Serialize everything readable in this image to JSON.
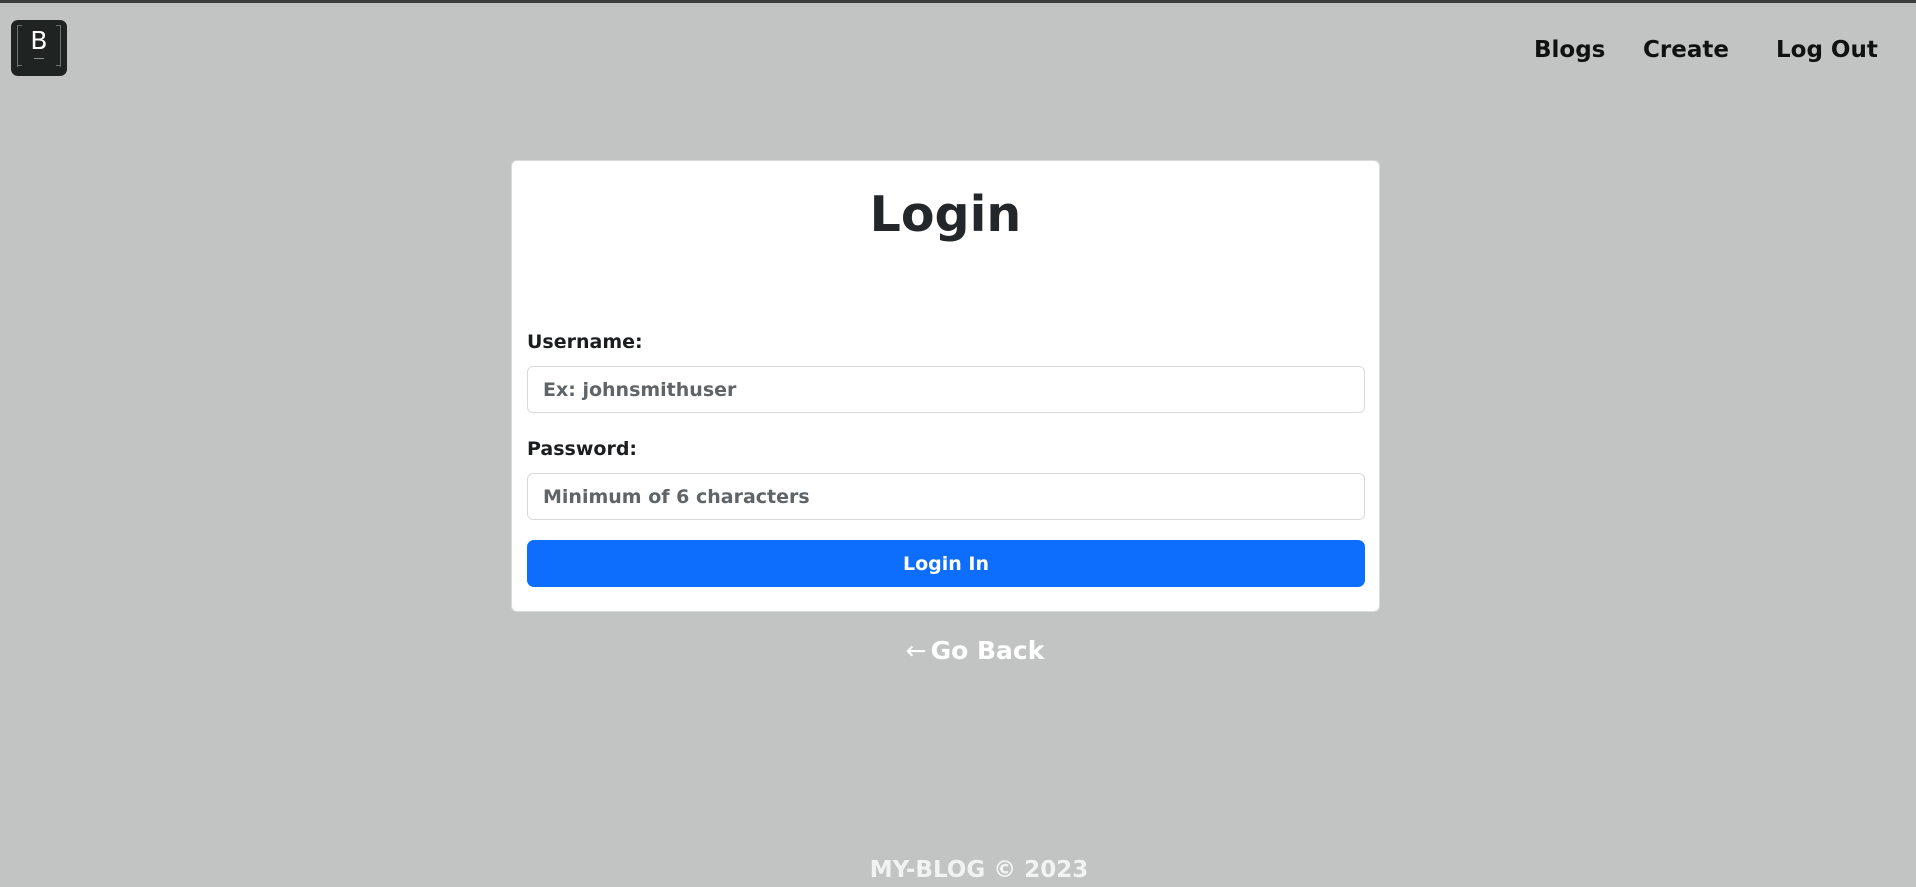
{
  "navbar": {
    "logo_letter": "B",
    "links": {
      "blogs": "Blogs",
      "create": "Create",
      "logout": "Log Out"
    }
  },
  "login_card": {
    "title": "Login",
    "username": {
      "label": "Username:",
      "placeholder": "Ex: johnsmithuser",
      "value": ""
    },
    "password": {
      "label": "Password:",
      "placeholder": "Minimum of 6 characters",
      "value": ""
    },
    "submit_label": "Login In"
  },
  "go_back": {
    "arrow": "←",
    "label": "Go Back"
  },
  "footer": {
    "text": "MY-BLOG © 2023"
  },
  "colors": {
    "background": "#c2c4c3",
    "primary_button": "#0d6efd",
    "logo_background": "#1f2322",
    "card_background": "#ffffff"
  }
}
